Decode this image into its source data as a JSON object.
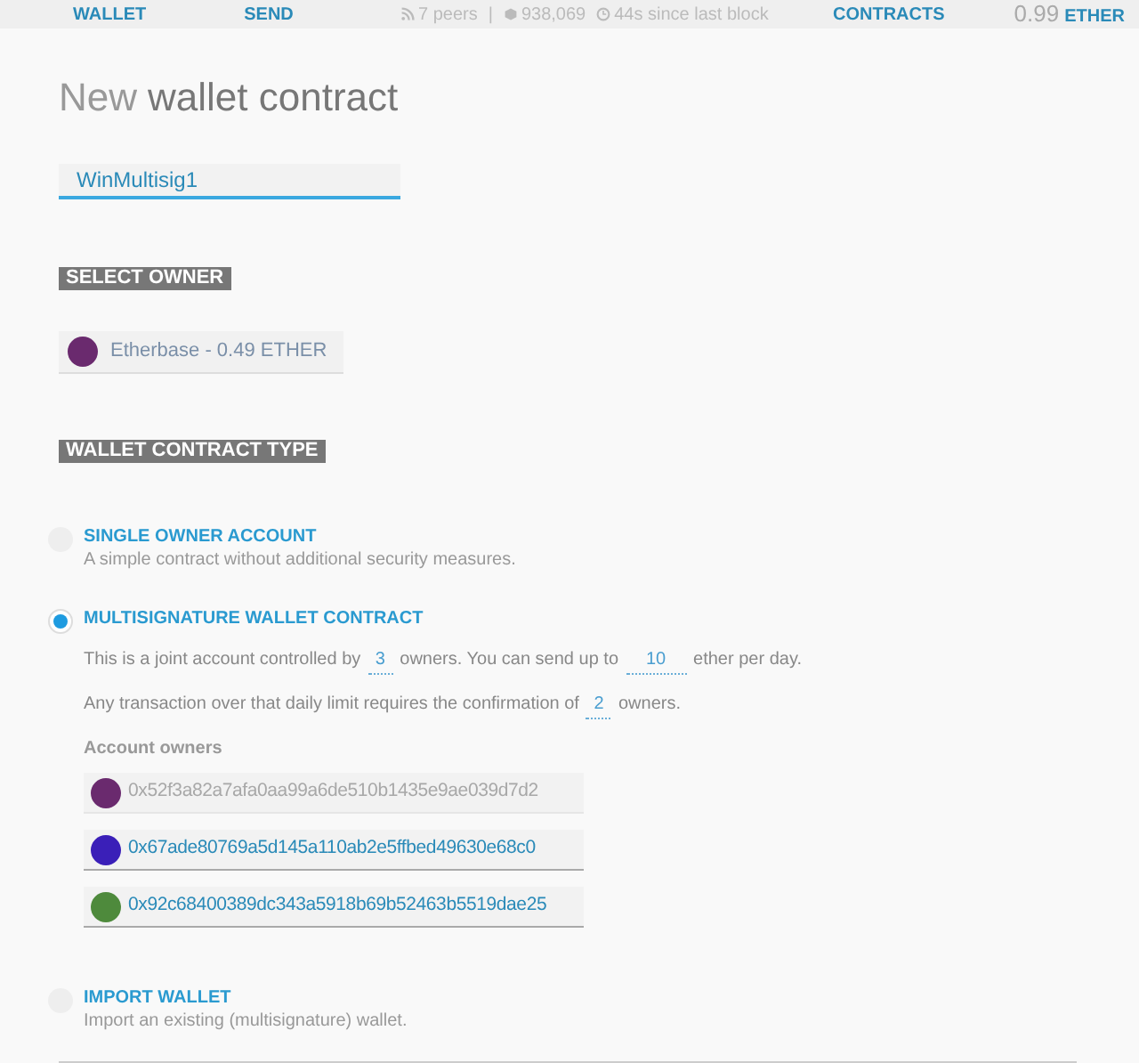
{
  "top_bar": {
    "nav_left": [
      {
        "label": "WALLET"
      },
      {
        "label": "SEND"
      }
    ],
    "status": [
      {
        "kind": "peers",
        "text": "7 peers"
      },
      {
        "kind": "separator",
        "text": "|"
      },
      {
        "kind": "block",
        "text": "938,069"
      },
      {
        "kind": "time",
        "text": "44s since last block"
      }
    ],
    "nav_right": [
      {
        "label": "CONTRACTS"
      }
    ],
    "balance": {
      "amount": "0.99",
      "unit": "ETHER"
    }
  },
  "title": {
    "light": "New",
    "bold": "wallet contract"
  },
  "name_field": {
    "value": "WinMultisig1"
  },
  "select_owner": {
    "heading": "SELECT OWNER",
    "value": "Etherbase - 0.49 ETHER",
    "color": "#6a2a6e"
  },
  "contract_type": {
    "heading": "WALLET CONTRACT TYPE",
    "options": [
      {
        "kind": "simple",
        "selected": false,
        "title": "SINGLE OWNER ACCOUNT",
        "description": "A simple contract without additional security measures."
      },
      {
        "kind": "multisig",
        "selected": true,
        "title": "MULTISIGNATURE WALLET CONTRACT",
        "lines": [
          [
            {
              "kind": "text",
              "text": "This is a joint account controlled by"
            },
            {
              "kind": "field",
              "text": "3"
            },
            {
              "kind": "text",
              "text": "owners. You can send up to"
            },
            {
              "kind": "field",
              "text": "10"
            },
            {
              "kind": "text",
              "text": "ether per day."
            }
          ],
          [
            {
              "kind": "text",
              "text": "Any transaction over that daily limit requires the confirmation of"
            },
            {
              "kind": "field",
              "text": "2"
            },
            {
              "kind": "text",
              "text": "owners."
            }
          ]
        ],
        "owners_label": "Account owners",
        "owners": [
          {
            "placeholder": "0x52f3a82a7afa0aa99a6de510b1435e9ae039d7d2",
            "color": "#6a2a6e"
          },
          {
            "value": "0x67ade80769a5d145a110ab2e5ffbed49630e68c0",
            "color": "#3a1fb8"
          },
          {
            "value": "0x92c68400389dc343a5918b69b52463b5519dae25",
            "color": "#4e8a3c"
          }
        ]
      },
      {
        "kind": "simple",
        "selected": false,
        "title": "IMPORT WALLET",
        "description": "Import an existing (multisignature) wallet."
      }
    ]
  }
}
